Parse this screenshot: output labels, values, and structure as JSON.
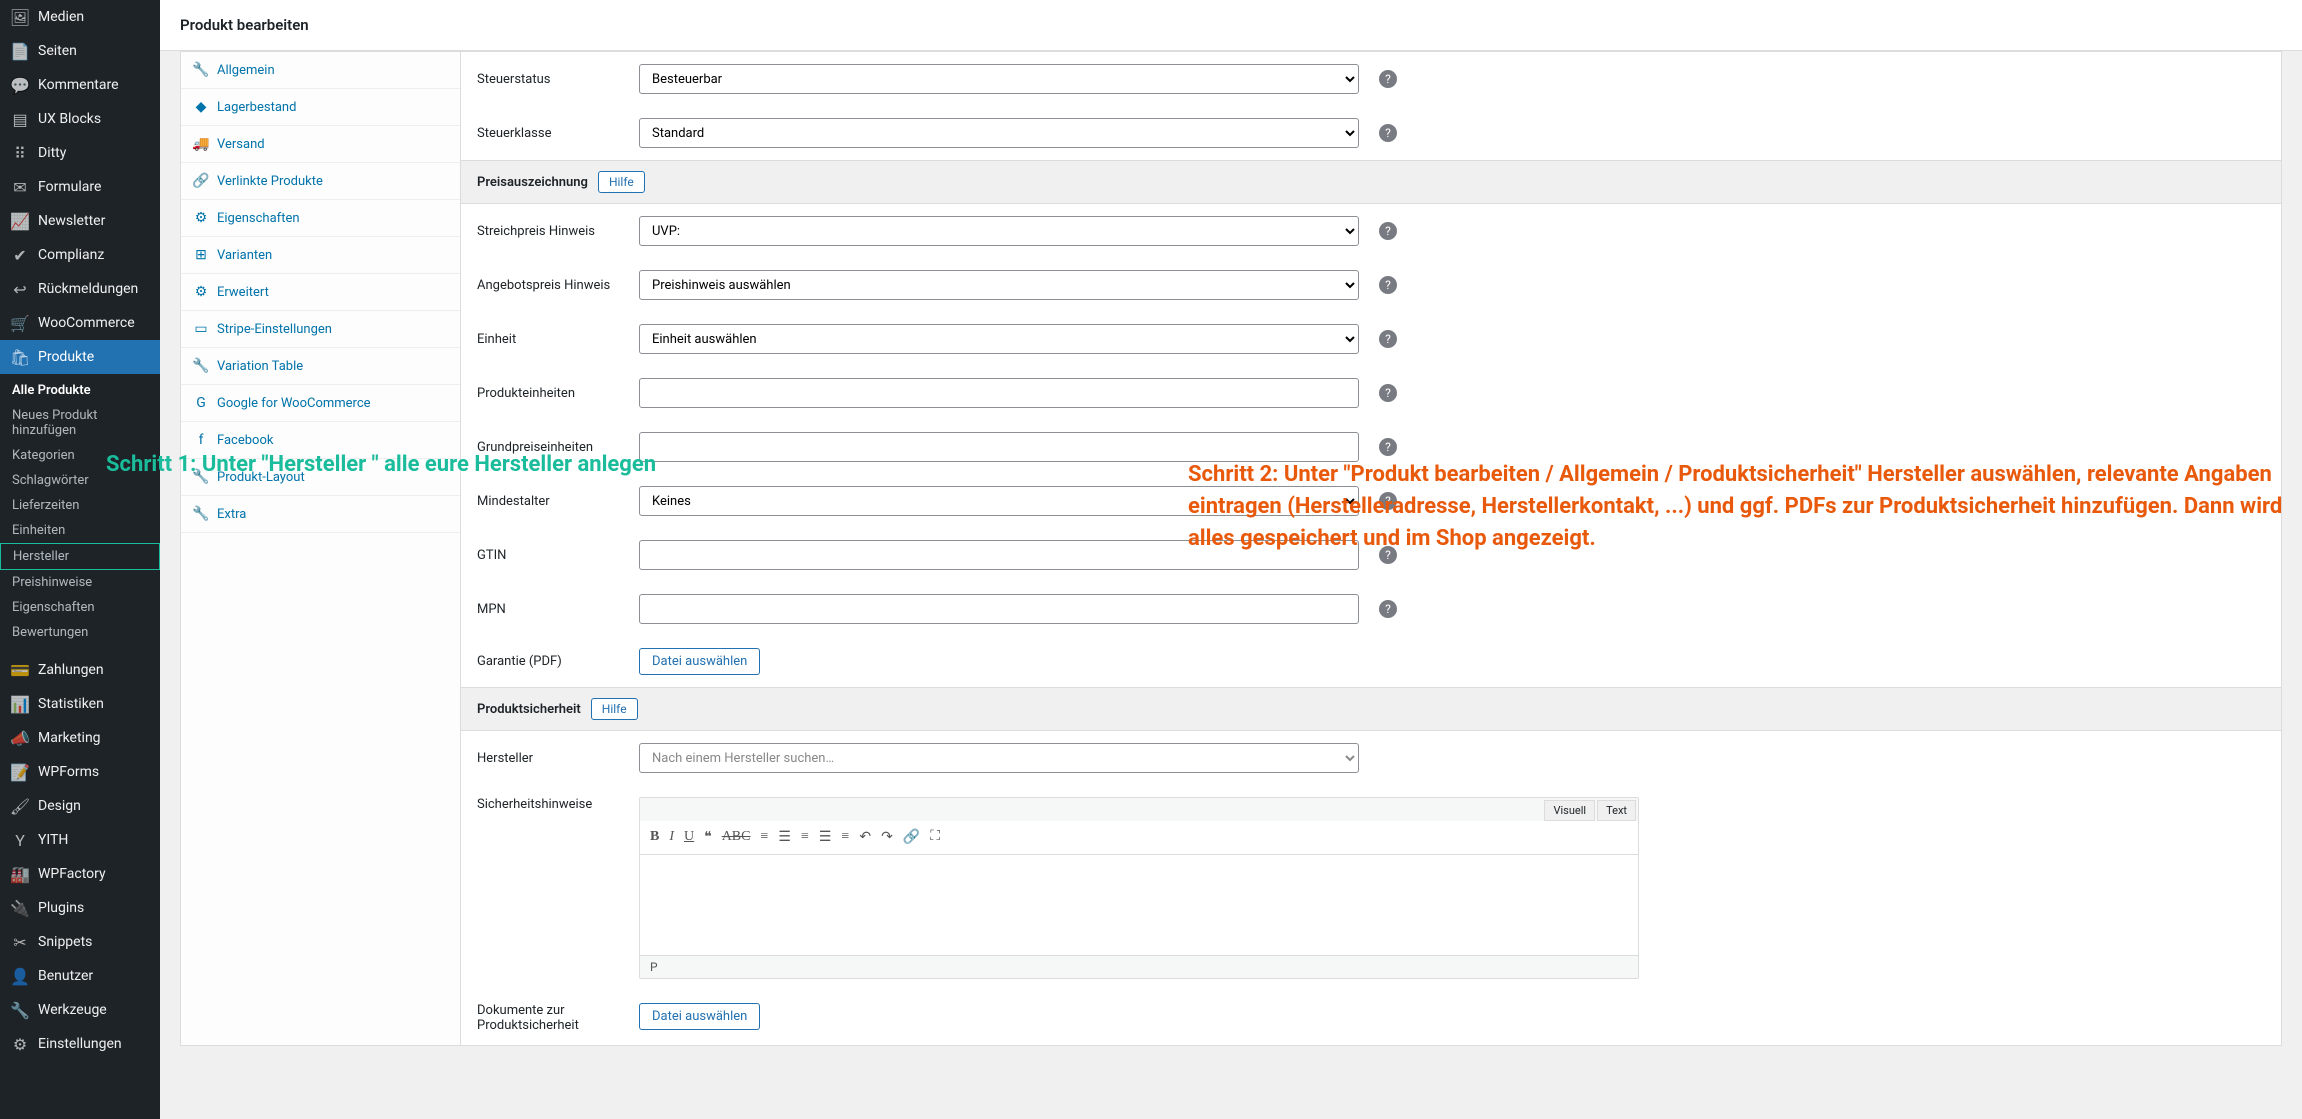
{
  "page_title": "Produkt bearbeiten",
  "sidebar": [
    {
      "icon": "🖼",
      "label": "Medien"
    },
    {
      "icon": "📄",
      "label": "Seiten"
    },
    {
      "icon": "💬",
      "label": "Kommentare"
    },
    {
      "icon": "▤",
      "label": "UX Blocks"
    },
    {
      "icon": "⠿",
      "label": "Ditty"
    },
    {
      "icon": "✉",
      "label": "Formulare"
    },
    {
      "icon": "📈",
      "label": "Newsletter"
    },
    {
      "icon": "✔",
      "label": "Complianz"
    },
    {
      "icon": "↩",
      "label": "Rückmeldungen"
    },
    {
      "icon": "🛒",
      "label": "WooCommerce"
    },
    {
      "icon": "🛍",
      "label": "Produkte",
      "active": true
    },
    {
      "icon": "💳",
      "label": "Zahlungen"
    },
    {
      "icon": "📊",
      "label": "Statistiken"
    },
    {
      "icon": "📣",
      "label": "Marketing"
    },
    {
      "icon": "📝",
      "label": "WPForms"
    },
    {
      "icon": "🖌",
      "label": "Design"
    },
    {
      "icon": "Y",
      "label": "YITH"
    },
    {
      "icon": "🏭",
      "label": "WPFactory"
    },
    {
      "icon": "🔌",
      "label": "Plugins"
    },
    {
      "icon": "✂",
      "label": "Snippets"
    },
    {
      "icon": "👤",
      "label": "Benutzer"
    },
    {
      "icon": "🔧",
      "label": "Werkzeuge"
    },
    {
      "icon": "⚙",
      "label": "Einstellungen"
    }
  ],
  "submenu": [
    {
      "label": "Alle Produkte",
      "current": true
    },
    {
      "label": "Neues Produkt hinzufügen"
    },
    {
      "label": "Kategorien"
    },
    {
      "label": "Schlagwörter"
    },
    {
      "label": "Lieferzeiten"
    },
    {
      "label": "Einheiten"
    },
    {
      "label": "Hersteller",
      "highlight": true
    },
    {
      "label": "Preishinweise"
    },
    {
      "label": "Eigenschaften"
    },
    {
      "label": "Bewertungen"
    }
  ],
  "tabs": [
    {
      "icon": "🔧",
      "label": "Allgemein"
    },
    {
      "icon": "◆",
      "label": "Lagerbestand"
    },
    {
      "icon": "🚚",
      "label": "Versand"
    },
    {
      "icon": "🔗",
      "label": "Verlinkte Produkte"
    },
    {
      "icon": "⚙",
      "label": "Eigenschaften"
    },
    {
      "icon": "⊞",
      "label": "Varianten"
    },
    {
      "icon": "⚙",
      "label": "Erweitert"
    },
    {
      "icon": "▭",
      "label": "Stripe-Einstellungen"
    },
    {
      "icon": "🔧",
      "label": "Variation Table"
    },
    {
      "icon": "G",
      "label": "Google for WooCommerce"
    },
    {
      "icon": "f",
      "label": "Facebook"
    },
    {
      "icon": "🔧",
      "label": "Produkt-Layout"
    },
    {
      "icon": "🔧",
      "label": "Extra"
    }
  ],
  "fields": {
    "tax_status": {
      "label": "Steuerstatus",
      "value": "Besteuerbar"
    },
    "tax_class": {
      "label": "Steuerklasse",
      "value": "Standard"
    },
    "section_price": "Preisauszeichnung",
    "help_btn": "Hilfe",
    "strike_hint": {
      "label": "Streichpreis Hinweis",
      "value": "UVP:"
    },
    "offer_hint": {
      "label": "Angebotspreis Hinweis",
      "value": "Preishinweis auswählen"
    },
    "unit": {
      "label": "Einheit",
      "value": "Einheit auswählen"
    },
    "product_units": {
      "label": "Produkteinheiten",
      "value": ""
    },
    "base_units": {
      "label": "Grundpreiseinheiten",
      "value": ""
    },
    "min_age": {
      "label": "Mindestalter",
      "value": "Keines"
    },
    "gtin": {
      "label": "GTIN",
      "value": ""
    },
    "mpn": {
      "label": "MPN",
      "value": ""
    },
    "warranty": {
      "label": "Garantie (PDF)",
      "btn": "Datei auswählen"
    },
    "section_safety": "Produktsicherheit",
    "manufacturer": {
      "label": "Hersteller",
      "placeholder": "Nach einem Hersteller suchen…"
    },
    "safety_notes": {
      "label": "Sicherheitshinweise"
    },
    "editor_tabs": {
      "visual": "Visuell",
      "text": "Text"
    },
    "editor_path": "P",
    "docs_safety": {
      "label": "Dokumente zur Produktsicherheit",
      "btn": "Datei auswählen"
    }
  },
  "annotations": {
    "step1": "Schritt 1: Unter \"Hersteller \" alle eure Hersteller anlegen",
    "step2": "Schritt 2: Unter \"Produkt bearbeiten / Allgemein / Produktsicherheit\" Hersteller auswählen, relevante Angaben eintragen (Herstelleradresse, Herstellerkontakt, ...) und ggf. PDFs zur Produktsicherheit hinzufügen. Dann wird alles gespeichert und im Shop angezeigt."
  }
}
